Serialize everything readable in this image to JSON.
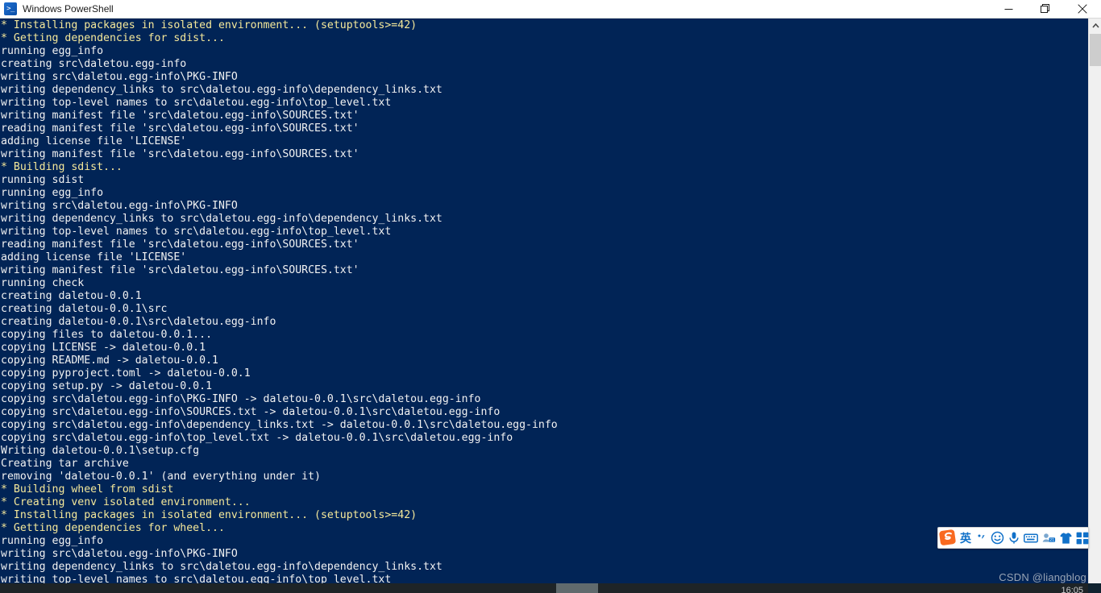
{
  "window": {
    "title": "Windows PowerShell",
    "app_icon": "powershell-icon",
    "icon_glyph": ">_",
    "background_color": "#012456",
    "text_color": "#f2f2f2",
    "highlight_color": "#f5e89a",
    "controls": {
      "minimize": "minimize-button",
      "maximize": "restore-button",
      "close": "close-button"
    }
  },
  "console": {
    "lines": [
      {
        "text": "* Installing packages in isolated environment... (setuptools>=42)",
        "highlight": true
      },
      {
        "text": "* Getting dependencies for sdist...",
        "highlight": true
      },
      {
        "text": "running egg_info",
        "highlight": false
      },
      {
        "text": "creating src\\daletou.egg-info",
        "highlight": false
      },
      {
        "text": "writing src\\daletou.egg-info\\PKG-INFO",
        "highlight": false
      },
      {
        "text": "writing dependency_links to src\\daletou.egg-info\\dependency_links.txt",
        "highlight": false
      },
      {
        "text": "writing top-level names to src\\daletou.egg-info\\top_level.txt",
        "highlight": false
      },
      {
        "text": "writing manifest file 'src\\daletou.egg-info\\SOURCES.txt'",
        "highlight": false
      },
      {
        "text": "reading manifest file 'src\\daletou.egg-info\\SOURCES.txt'",
        "highlight": false
      },
      {
        "text": "adding license file 'LICENSE'",
        "highlight": false
      },
      {
        "text": "writing manifest file 'src\\daletou.egg-info\\SOURCES.txt'",
        "highlight": false
      },
      {
        "text": "* Building sdist...",
        "highlight": true
      },
      {
        "text": "running sdist",
        "highlight": false
      },
      {
        "text": "running egg_info",
        "highlight": false
      },
      {
        "text": "writing src\\daletou.egg-info\\PKG-INFO",
        "highlight": false
      },
      {
        "text": "writing dependency_links to src\\daletou.egg-info\\dependency_links.txt",
        "highlight": false
      },
      {
        "text": "writing top-level names to src\\daletou.egg-info\\top_level.txt",
        "highlight": false
      },
      {
        "text": "reading manifest file 'src\\daletou.egg-info\\SOURCES.txt'",
        "highlight": false
      },
      {
        "text": "adding license file 'LICENSE'",
        "highlight": false
      },
      {
        "text": "writing manifest file 'src\\daletou.egg-info\\SOURCES.txt'",
        "highlight": false
      },
      {
        "text": "running check",
        "highlight": false
      },
      {
        "text": "creating daletou-0.0.1",
        "highlight": false
      },
      {
        "text": "creating daletou-0.0.1\\src",
        "highlight": false
      },
      {
        "text": "creating daletou-0.0.1\\src\\daletou.egg-info",
        "highlight": false
      },
      {
        "text": "copying files to daletou-0.0.1...",
        "highlight": false
      },
      {
        "text": "copying LICENSE -> daletou-0.0.1",
        "highlight": false
      },
      {
        "text": "copying README.md -> daletou-0.0.1",
        "highlight": false
      },
      {
        "text": "copying pyproject.toml -> daletou-0.0.1",
        "highlight": false
      },
      {
        "text": "copying setup.py -> daletou-0.0.1",
        "highlight": false
      },
      {
        "text": "copying src\\daletou.egg-info\\PKG-INFO -> daletou-0.0.1\\src\\daletou.egg-info",
        "highlight": false
      },
      {
        "text": "copying src\\daletou.egg-info\\SOURCES.txt -> daletou-0.0.1\\src\\daletou.egg-info",
        "highlight": false
      },
      {
        "text": "copying src\\daletou.egg-info\\dependency_links.txt -> daletou-0.0.1\\src\\daletou.egg-info",
        "highlight": false
      },
      {
        "text": "copying src\\daletou.egg-info\\top_level.txt -> daletou-0.0.1\\src\\daletou.egg-info",
        "highlight": false
      },
      {
        "text": "Writing daletou-0.0.1\\setup.cfg",
        "highlight": false
      },
      {
        "text": "Creating tar archive",
        "highlight": false
      },
      {
        "text": "removing 'daletou-0.0.1' (and everything under it)",
        "highlight": false
      },
      {
        "text": "* Building wheel from sdist",
        "highlight": true
      },
      {
        "text": "* Creating venv isolated environment...",
        "highlight": true
      },
      {
        "text": "* Installing packages in isolated environment... (setuptools>=42)",
        "highlight": true
      },
      {
        "text": "* Getting dependencies for wheel...",
        "highlight": true
      },
      {
        "text": "running egg_info",
        "highlight": false
      },
      {
        "text": "writing src\\daletou.egg-info\\PKG-INFO",
        "highlight": false
      },
      {
        "text": "writing dependency_links to src\\daletou.egg-info\\dependency_links.txt",
        "highlight": false
      },
      {
        "text": "writing top-level names to src\\daletou.egg-info\\top_level.txt",
        "highlight": false
      }
    ]
  },
  "scrollbar": {
    "up_arrow": "scroll-up-arrow",
    "down_arrow": "scroll-down-arrow",
    "thumb": "scroll-thumb"
  },
  "ime_toolbar": {
    "logo_label": "S",
    "items": [
      {
        "name": "language-mode-toggle",
        "glyph": "英",
        "kind": "cn"
      },
      {
        "name": "punctuation-toggle",
        "glyph": "，",
        "kind": "icon"
      },
      {
        "name": "emoji-icon",
        "glyph": "☺",
        "kind": "icon"
      },
      {
        "name": "voice-input-icon",
        "glyph": "🎤",
        "kind": "icon"
      },
      {
        "name": "soft-keyboard-icon",
        "glyph": "⌨",
        "kind": "icon"
      },
      {
        "name": "user-account-icon",
        "glyph": "👤",
        "kind": "icon"
      },
      {
        "name": "skins-icon",
        "glyph": "👕",
        "kind": "icon"
      },
      {
        "name": "toolbox-icon",
        "glyph": "▦",
        "kind": "icon"
      }
    ]
  },
  "watermark": {
    "text": "CSDN @liangblog"
  },
  "taskbar": {
    "clock": "16:05"
  }
}
